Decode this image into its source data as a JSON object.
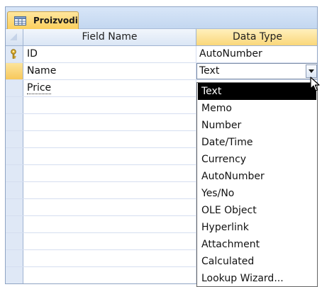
{
  "table_tab": {
    "label": "Proizvodi",
    "icon": "table-icon"
  },
  "grid": {
    "headers": {
      "field_name": "Field Name",
      "data_type": "Data Type"
    },
    "rows": [
      {
        "field_name": "ID",
        "data_type": "AutoNumber",
        "primary_key": true,
        "key_icon": "primary-key-icon"
      },
      {
        "field_name": "Name",
        "data_type": "Text",
        "current": true
      },
      {
        "field_name": "Price",
        "data_type": ""
      }
    ]
  },
  "data_type_combo": {
    "value": "Text",
    "button_icon": "dropdown-arrow-icon"
  },
  "data_type_options": [
    "Text",
    "Memo",
    "Number",
    "Date/Time",
    "Currency",
    "AutoNumber",
    "Yes/No",
    "OLE Object",
    "Hyperlink",
    "Attachment",
    "Calculated",
    "Lookup Wizard..."
  ],
  "selected_option": "Text",
  "colors": {
    "tab_active": "#fbcf5c",
    "header_active": "#fad77a",
    "row_selector": "#dfe8f6",
    "selected_option_bg": "#000000"
  }
}
